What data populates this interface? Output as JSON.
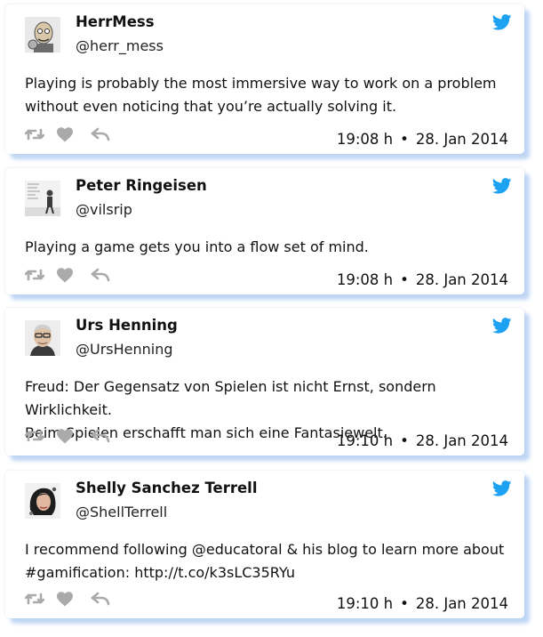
{
  "tweets": [
    {
      "name": "HerrMess",
      "handle": "@herr_mess",
      "text_lines": [
        "Playing is probably the most immersive way to work on a problem",
        "without even noticing that you’re actually solving it."
      ],
      "time": "19:08 h",
      "date": "28. Jan 2014"
    },
    {
      "name": "Peter Ringeisen",
      "handle": "@vilsrip",
      "text_lines": [
        "Playing a game gets you into a flow set of mind."
      ],
      "time": "19:08 h",
      "date": "28. Jan 2014"
    },
    {
      "name": "Urs Henning",
      "handle": "@UrsHenning",
      "text_lines": [
        "Freud: Der Gegensatz von Spielen ist nicht Ernst, sondern Wirklichkeit.",
        "Beim Spielen erschafft man sich eine Fantasiewelt."
      ],
      "time": "19:10 h",
      "date": "28. Jan 2014"
    },
    {
      "name": "Shelly Sanchez Terrell",
      "handle": "@ShellTerrell",
      "text_lines": [
        "I recommend following @educatoral & his blog to learn more about",
        "#gamification: http://t.co/k3sLC35RYu"
      ],
      "time": "19:10 h",
      "date": "28. Jan 2014"
    }
  ],
  "icons": {
    "brand": "twitter-bird-icon",
    "retweet": "retweet-icon",
    "like": "heart-icon",
    "reply": "reply-icon"
  },
  "colors": {
    "twitter_blue": "#1da1f2",
    "action_gray": "#aaaaaa",
    "card_shadow": "#c2d8f6"
  }
}
